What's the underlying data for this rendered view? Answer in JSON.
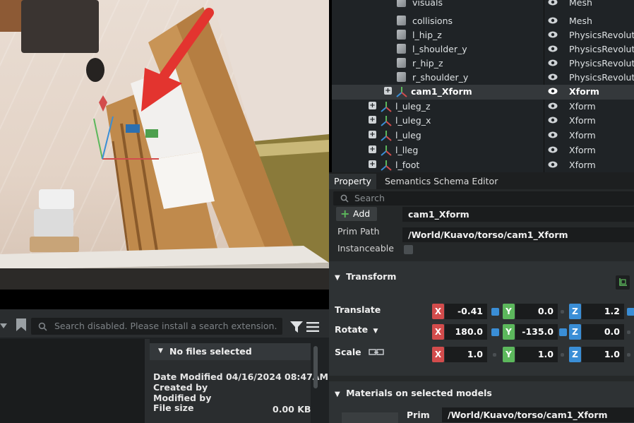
{
  "stage_tree": {
    "rows": [
      {
        "name": "visuals",
        "type": "Mesh"
      },
      {
        "name": "collisions",
        "type": "Mesh"
      },
      {
        "name": "l_hip_z",
        "type": "PhysicsRevolute"
      },
      {
        "name": "l_shoulder_y",
        "type": "PhysicsRevolute"
      },
      {
        "name": "r_hip_z",
        "type": "PhysicsRevolute"
      },
      {
        "name": "r_shoulder_y",
        "type": "PhysicsRevolute"
      },
      {
        "name": "cam1_Xform",
        "type": "Xform"
      },
      {
        "name": "l_uleg_z",
        "type": "Xform"
      },
      {
        "name": "l_uleg_x",
        "type": "Xform"
      },
      {
        "name": "l_uleg",
        "type": "Xform"
      },
      {
        "name": "l_lleg",
        "type": "Xform"
      },
      {
        "name": "l_foot",
        "type": "Xform"
      }
    ]
  },
  "property": {
    "tabs": [
      "Property",
      "Semantics Schema Editor"
    ],
    "search_placeholder": "Search",
    "add_label": "Add",
    "prim_name": "cam1_Xform",
    "prim_path_label": "Prim Path",
    "prim_path": "/World/Kuavo/torso/cam1_Xform",
    "instanceable_label": "Instanceable",
    "transform": {
      "title": "Transform",
      "translate_label": "Translate",
      "rotate_label": "Rotate",
      "scale_label": "Scale",
      "axis_x": "X",
      "axis_y": "Y",
      "axis_z": "Z",
      "translate": [
        "-0.41",
        "0.0",
        "1.2"
      ],
      "rotate": [
        "180.0",
        "-135.0",
        "0.0"
      ],
      "scale": [
        "1.0",
        "1.0",
        "1.0"
      ]
    },
    "materials": {
      "title": "Materials on selected models",
      "prim_label": "Prim",
      "prim_value": "/World/Kuavo/torso/cam1_Xform"
    }
  },
  "content_browser": {
    "search_placeholder": "Search disabled. Please install a search extension.",
    "details": {
      "title": "No files selected",
      "date_modified_label": "Date Modified",
      "date_modified": "04/16/2024 08:47AM",
      "created_by_label": "Created by",
      "modified_by_label": "Modified by",
      "file_size_label": "File size",
      "file_size": "0.00 KB"
    }
  },
  "colors": {
    "accent_x": "#d34c4c",
    "accent_y": "#5cb85c",
    "accent_z": "#3a8ed6",
    "annotation_arrow": "#e3342f"
  }
}
